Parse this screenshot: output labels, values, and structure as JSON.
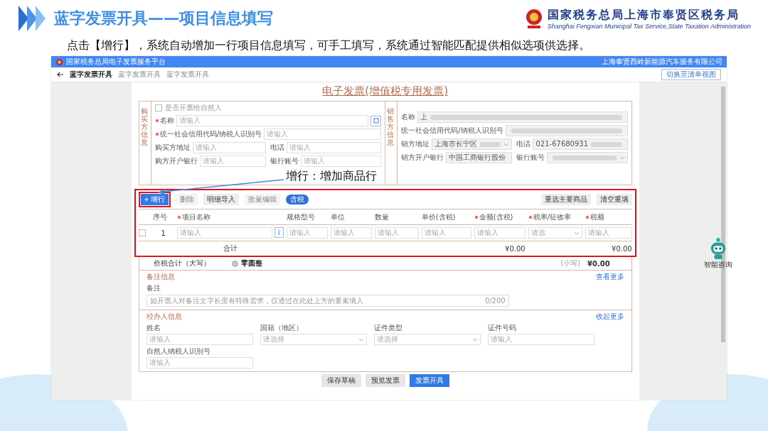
{
  "slide": {
    "title": "蓝字发票开具——项目信息填写",
    "org": "国家税务总局上海市奉贤区税务局",
    "org_en": "Shanghai Fengxian Municipal Tax Service,State Taxation Administration",
    "caption": "点击【增行】，系统自动增加一行项目信息填写，可手工填写，系统通过智能匹配提供相似选项供选择。",
    "callout": "增行：增加商品行"
  },
  "app": {
    "title": "国家税务总局电子发票服务平台",
    "user": "上海奉贤西岭新能源汽车服务有限公司",
    "page_title": "蓝字发票开具",
    "breadcrumb": [
      "蓝字发票开具",
      "蓝字发票开具"
    ],
    "switch_button": "切换至清单视图"
  },
  "invoice_title": "电子发票(增值税专用发票)",
  "buyer": {
    "side_label": "购买方信息",
    "natural_person": {
      "label": "是否开票给自然人",
      "checked": false
    },
    "fields": [
      {
        "label": "名称",
        "required": true,
        "placeholder": "请输入",
        "kind": "wide-button"
      },
      {
        "label": "统一社会信用代码/纳税人识别号",
        "required": true,
        "placeholder": "请输入",
        "kind": "wide"
      },
      {
        "label": "购买方地址",
        "required": false,
        "placeholder": "请输入",
        "kind": "half"
      },
      {
        "label": "电话",
        "required": false,
        "placeholder": "请输入",
        "kind": "half"
      },
      {
        "label": "购方开户银行",
        "required": false,
        "placeholder": "请输入",
        "kind": "half"
      },
      {
        "label": "银行账号",
        "required": false,
        "placeholder": "请输入",
        "kind": "half"
      }
    ]
  },
  "seller": {
    "side_label": "销售方信息",
    "fields": [
      {
        "label": "名称",
        "value": "上",
        "kind": "wide"
      },
      {
        "label": "统一社会信用代码/纳税人识别号",
        "kind": "wide"
      },
      {
        "label": "销方地址",
        "value": "上海市长宁区",
        "kind": "half-select"
      },
      {
        "label": "电话",
        "value": "021-67680931",
        "kind": "half"
      },
      {
        "label": "销方开户银行",
        "value": "中国工商银行股份",
        "kind": "half"
      },
      {
        "label": "银行账号",
        "kind": "half-select"
      }
    ]
  },
  "toolbar": {
    "buttons": [
      {
        "label": "增行",
        "kind": "primary",
        "disabled": false
      },
      {
        "label": "删除",
        "kind": "default",
        "disabled": true
      },
      {
        "label": "明细导入",
        "kind": "default",
        "disabled": false
      },
      {
        "label": "批量编辑",
        "kind": "default",
        "disabled": true
      }
    ],
    "toggle": {
      "label": "含税",
      "on": true
    },
    "right_buttons": [
      "重选主要商品",
      "清空重填"
    ]
  },
  "table": {
    "columns": [
      {
        "label": "序号",
        "required": false
      },
      {
        "label": "项目名称",
        "required": true
      },
      {
        "label": "规格型号",
        "required": false
      },
      {
        "label": "单位",
        "required": false
      },
      {
        "label": "数量",
        "required": false
      },
      {
        "label": "单价(含税)",
        "required": false
      },
      {
        "label": "金额(含税)",
        "required": true
      },
      {
        "label": "税率/征收率",
        "required": true
      },
      {
        "label": "税额",
        "required": true
      }
    ],
    "rows": [
      {
        "selected": false,
        "cells": [
          {
            "kind": "text",
            "text": "1"
          },
          {
            "kind": "input-button",
            "placeholder": "请输入",
            "button": "i"
          },
          {
            "kind": "input",
            "placeholder": "请输入"
          },
          {
            "kind": "input",
            "placeholder": "请输入"
          },
          {
            "kind": "input",
            "placeholder": "请输入"
          },
          {
            "kind": "input",
            "placeholder": "请输入"
          },
          {
            "kind": "input",
            "placeholder": "请输入"
          },
          {
            "kind": "select",
            "placeholder": "请选"
          },
          {
            "kind": "input",
            "placeholder": "请输入"
          }
        ]
      }
    ],
    "total": {
      "label": "合计",
      "amount": "¥0.00",
      "tax": "¥0.00"
    }
  },
  "grand_total": {
    "label": "价税合计（大写）",
    "uppercase": "零圆整",
    "small_label": "(小写)",
    "small": "¥0.00"
  },
  "remark": {
    "heading": "备注信息",
    "more": "查看更多",
    "label": "备注",
    "placeholder": "如开票人对备注文字长度有特殊需求，仅通过在此处上方的要素填入",
    "counter": "0/200"
  },
  "handler": {
    "heading": "经办人信息",
    "more": "收起更多",
    "fields": [
      {
        "label": "姓名",
        "placeholder": "请输入",
        "kind": "input"
      },
      {
        "label": "国籍（地区）",
        "placeholder": "请选择",
        "kind": "select"
      },
      {
        "label": "证件类型",
        "placeholder": "请选择",
        "kind": "select"
      },
      {
        "label": "证件号码",
        "placeholder": "请输入",
        "kind": "input"
      },
      {
        "label": "自然人纳税人识别号",
        "placeholder": "请输入",
        "kind": "input"
      }
    ]
  },
  "footer_buttons": [
    {
      "label": "保存草稿",
      "kind": "default"
    },
    {
      "label": "预览发票",
      "kind": "default"
    },
    {
      "label": "发票开具",
      "kind": "primary"
    }
  ],
  "assistant": {
    "label": "智能咨询"
  }
}
